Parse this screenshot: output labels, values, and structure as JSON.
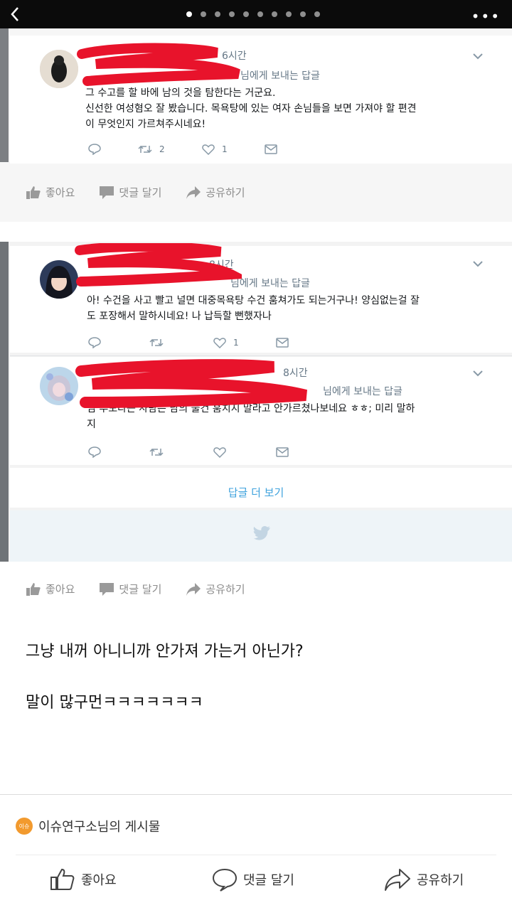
{
  "topbar": {
    "page_count": 10,
    "active_page": 1,
    "back_icon": "chevron-left-icon",
    "more_icon": "ellipsis-icon",
    "more_label": "•••"
  },
  "shot1": {
    "tweet": {
      "time": "6시간",
      "reply_to": "님에게 보내는 답글",
      "text_line1": "그 수고를 할 바에 남의 것을 탐한다는 거군요.",
      "text_line2": "신선한 여성혐오 잘 봤습니다. 목욕탕에 있는 여자 손님들을 보면 가져야 할 편견",
      "text_line3": "이 무엇인지 가르쳐주시네요!",
      "retweets": "2",
      "likes": "1"
    },
    "fb_actions": {
      "like": "좋아요",
      "comment": "댓글 달기",
      "share": "공유하기"
    }
  },
  "shot2": {
    "tweet1": {
      "time": "8시간",
      "reply_to": "님에게 보내는 답글",
      "text_line1": "아! 수건을 사고 빨고 널면 대중목욕탕 수건 훔쳐가도 되는거구나! 양심없는걸 잘",
      "text_line2": "도 포장해서 말하시네요! 나 납득할 뻔했자나",
      "retweets": "",
      "likes": "1"
    },
    "tweet2": {
      "time": "8시간",
      "reply_to": "님에게 보내는 답글",
      "text_line1": "님 부모라는 사람은 남의 물건 훔치지 말라고 안가르쳤나보네요 ㅎㅎ; 미리 말하",
      "text_line2": "지",
      "retweets": "",
      "likes": ""
    },
    "more_replies": "답글 더 보기",
    "fb_actions": {
      "like": "좋아요",
      "comment": "댓글 달기",
      "share": "공유하기"
    }
  },
  "post": {
    "line1": "그냥 내꺼 아니니까 안가져 가는거 아닌가?",
    "line2": "말이 많구먼ㅋㅋㅋㅋㅋㅋㅋ"
  },
  "author": {
    "badge_text": "이슈\n연구소",
    "name": "이슈연구소님의 게시물"
  },
  "bottom_actions": {
    "like": "좋아요",
    "comment": "댓글 달기",
    "share": "공유하기"
  },
  "colors": {
    "twitter_blue": "#1da1f2",
    "link_blue": "#3ea2dd",
    "redaction": "#e8132b",
    "badge": "#f29a2e"
  }
}
